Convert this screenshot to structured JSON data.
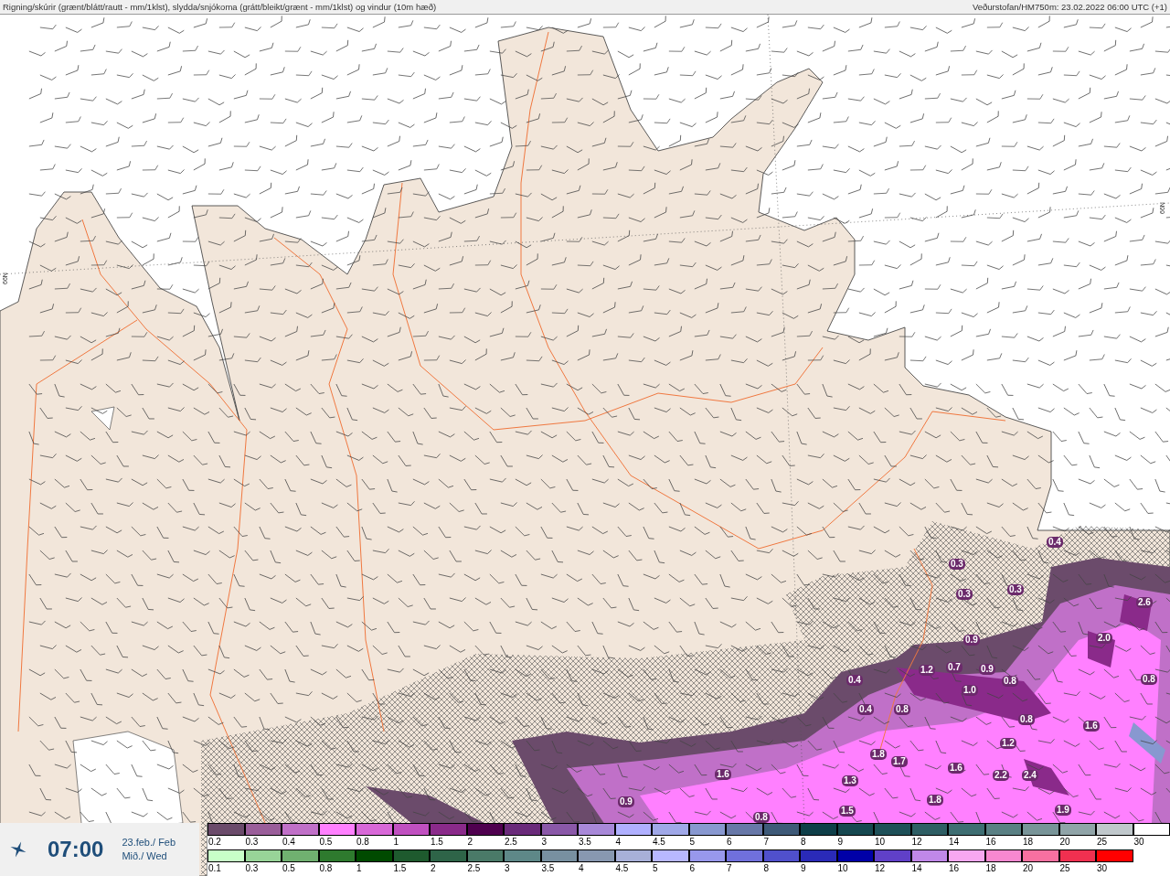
{
  "header": {
    "title": "Rigning/skúrir (grænt/blátt/rautt - mm/1klst), slydda/snjókoma (grátt/bleikt/grænt - mm/1klst) og vindur (10m hæð)",
    "source": "Veðurstofan/HM750m: 23.02.2022 06:00 UTC (+1)"
  },
  "map": {
    "latitude_labels": [
      "66N",
      "66N"
    ],
    "value_labels": [
      "0.4",
      "0.3",
      "0.3",
      "0.3",
      "2.6",
      "0.9",
      "2.0",
      "0.4",
      "1.2",
      "0.7",
      "0.9",
      "0.8",
      "0.8",
      "1.0",
      "0.4",
      "0.8",
      "0.8",
      "1.6",
      "1.2",
      "1.8",
      "1.7",
      "1.6",
      "1.3",
      "1.6",
      "2.2",
      "2.4",
      "0.9",
      "0.8",
      "1.5",
      "1.8",
      "1.9"
    ]
  },
  "time_panel": {
    "time": "07:00",
    "date": "23.feb./ Feb",
    "weekday": "Mið./ Wed"
  },
  "legend": {
    "upper_scale": [
      {
        "label": "0.2",
        "color": "#6b4b6b"
      },
      {
        "label": "0.3",
        "color": "#9a5e9a"
      },
      {
        "label": "0.4",
        "color": "#c070c8"
      },
      {
        "label": "0.5",
        "color": "#ff80ff"
      },
      {
        "label": "0.8",
        "color": "#d868d8"
      },
      {
        "label": "1",
        "color": "#c050c0"
      },
      {
        "label": "1.5",
        "color": "#8a2a8a"
      },
      {
        "label": "2",
        "color": "#4f004f"
      },
      {
        "label": "2.5",
        "color": "#6a2a7a"
      },
      {
        "label": "3",
        "color": "#8a58a8"
      },
      {
        "label": "3.5",
        "color": "#a888d8"
      },
      {
        "label": "4",
        "color": "#b0b0ff"
      },
      {
        "label": "4.5",
        "color": "#a0a8e8"
      },
      {
        "label": "5",
        "color": "#8898d0"
      },
      {
        "label": "6",
        "color": "#6878a8"
      },
      {
        "label": "7",
        "color": "#3e5a78"
      },
      {
        "label": "8",
        "color": "#0e3e48"
      },
      {
        "label": "9",
        "color": "#164850"
      },
      {
        "label": "10",
        "color": "#1e5058"
      },
      {
        "label": "12",
        "color": "#2e5e64"
      },
      {
        "label": "14",
        "color": "#3e6e72"
      },
      {
        "label": "16",
        "color": "#5a8084"
      },
      {
        "label": "18",
        "color": "#789498"
      },
      {
        "label": "20",
        "color": "#90a4a8"
      },
      {
        "label": "25",
        "color": "#c0c8cc"
      },
      {
        "label": "30",
        "color": "#ffffff"
      }
    ],
    "lower_scale": [
      {
        "label": "0.1",
        "color": "#c8ffc8"
      },
      {
        "label": "0.3",
        "color": "#98d498"
      },
      {
        "label": "0.5",
        "color": "#70b070"
      },
      {
        "label": "0.8",
        "color": "#2e7a2e"
      },
      {
        "label": "1",
        "color": "#004a00"
      },
      {
        "label": "1.5",
        "color": "#1e5a2e"
      },
      {
        "label": "2",
        "color": "#2e6448"
      },
      {
        "label": "2.5",
        "color": "#4a7a68"
      },
      {
        "label": "3",
        "color": "#5e8888"
      },
      {
        "label": "3.5",
        "color": "#7890a0"
      },
      {
        "label": "4",
        "color": "#8898b0"
      },
      {
        "label": "4.5",
        "color": "#a8b0d8"
      },
      {
        "label": "5",
        "color": "#b8b8ff"
      },
      {
        "label": "6",
        "color": "#9898ec"
      },
      {
        "label": "7",
        "color": "#7070dc"
      },
      {
        "label": "8",
        "color": "#5050cc"
      },
      {
        "label": "9",
        "color": "#2a2ab8"
      },
      {
        "label": "10",
        "color": "#0000a8"
      },
      {
        "label": "12",
        "color": "#6040c8"
      },
      {
        "label": "14",
        "color": "#c088e8"
      },
      {
        "label": "16",
        "color": "#f8a8f0"
      },
      {
        "label": "18",
        "color": "#f888d0"
      },
      {
        "label": "20",
        "color": "#f870a0"
      },
      {
        "label": "25",
        "color": "#f03050"
      },
      {
        "label": "30",
        "color": "#ff0000"
      }
    ]
  }
}
